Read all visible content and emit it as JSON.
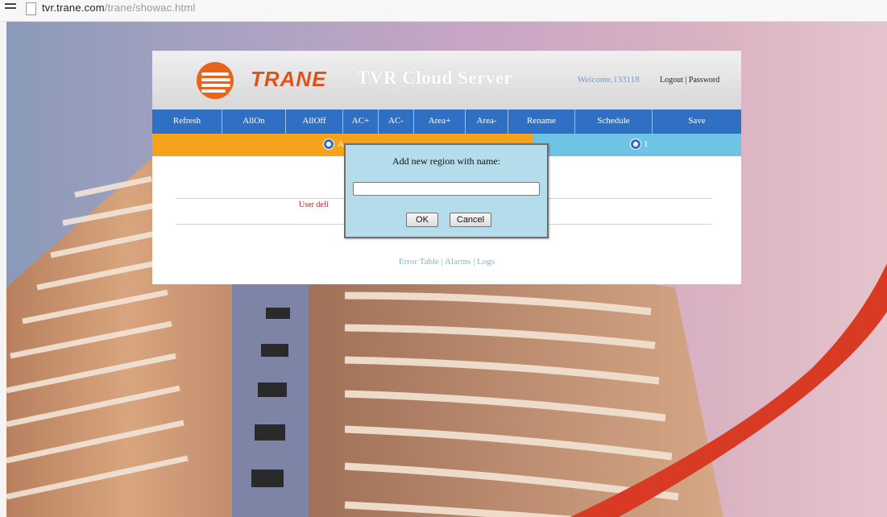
{
  "browser": {
    "url_host": "tvr.trane.com",
    "url_path": "/trane/showac.html"
  },
  "header": {
    "logo_text": "TRANE",
    "app_title": "TVR Cloud Server",
    "welcome": "Welcome,133118",
    "logout": "Logout",
    "separator": "|",
    "password": "Password"
  },
  "toolbar": {
    "buttons": [
      "Refresh",
      "AllOn",
      "AllOff",
      "AC+",
      "AC-",
      "Area+",
      "Area-",
      "Rename",
      "Schedule",
      "Save"
    ]
  },
  "areas": {
    "first_label": "A",
    "second_label": "1"
  },
  "content": {
    "user_defined_text": "User defi",
    "footer": {
      "error_table": "Error Table",
      "alarms": "Alarms",
      "logs": "Logs",
      "sep": " | "
    }
  },
  "dialog": {
    "title": "Add new region with name:",
    "input_value": "",
    "input_placeholder": "",
    "ok_label": "OK",
    "cancel_label": "Cancel"
  },
  "colors": {
    "toolbar": "#2f70c4",
    "area_active": "#f5a21c",
    "area_inactive": "#6fc3e4",
    "brand": "#e0521a",
    "dialog_bg": "#b5dceb"
  }
}
